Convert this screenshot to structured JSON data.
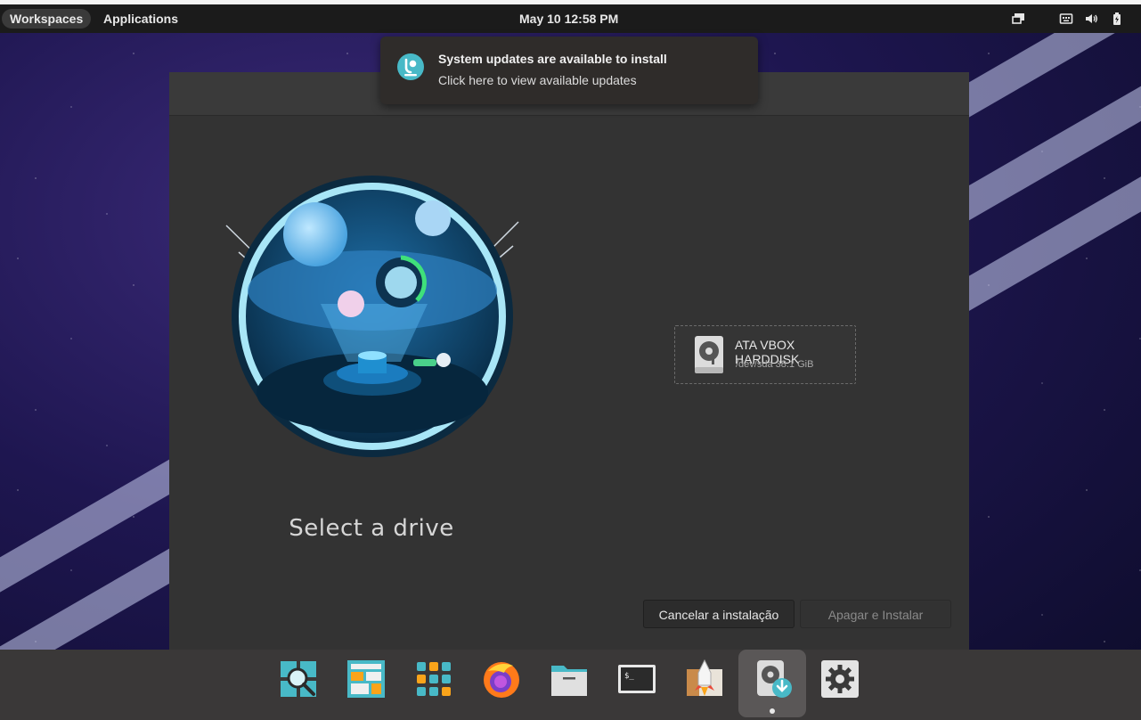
{
  "topbar": {
    "workspaces_label": "Workspaces",
    "applications_label": "Applications",
    "clock": "May 10  12:58 PM",
    "tray_icons": [
      "display-icon",
      "keyboard-icon",
      "volume-icon",
      "battery-icon"
    ]
  },
  "notification": {
    "title": "System updates are available to install",
    "body": "Click here to view available updates",
    "icon": "pop-shop-icon"
  },
  "installer": {
    "heading": "Select a drive",
    "drive": {
      "name": "ATA VBOX HARDDISK",
      "info": "/dev/sda 38.1 GiB",
      "icon": "harddisk-icon"
    },
    "cancel_label": "Cancelar a instalação",
    "erase_label": "Apagar e Instalar"
  },
  "dock": {
    "items": [
      {
        "name": "search-app-icon"
      },
      {
        "name": "workspaces-app-icon"
      },
      {
        "name": "app-library-icon"
      },
      {
        "name": "firefox-icon"
      },
      {
        "name": "files-icon"
      },
      {
        "name": "terminal-icon"
      },
      {
        "name": "installer-launcher-icon"
      },
      {
        "name": "installer-app-icon",
        "active": true
      },
      {
        "name": "settings-icon"
      }
    ]
  },
  "colors": {
    "accent": "#48b9c7",
    "window_bg": "#333333",
    "topbar_bg": "#1b1b1b",
    "dock_bg": "#3a3838"
  }
}
